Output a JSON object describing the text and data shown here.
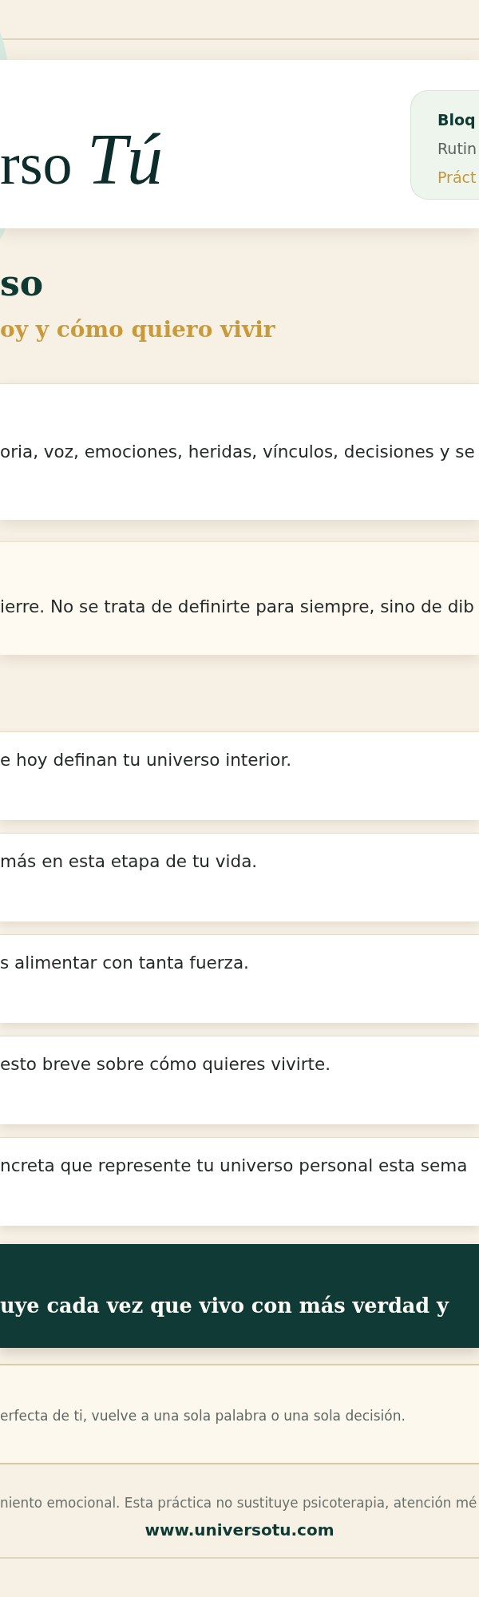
{
  "header": {
    "logo": {
      "text": "rso",
      "accent": "Tú"
    },
    "badge": {
      "lines": [
        {
          "kind": "title",
          "text": "Bloq"
        },
        {
          "kind": "subtitle",
          "text": "Rutin"
        },
        {
          "kind": "tag",
          "text": "Práct"
        }
      ]
    }
  },
  "hero": {
    "title": "so",
    "subtitle": "oy y cómo quiero vivir"
  },
  "intro_cards": [
    {
      "kind": "plain",
      "text": "oria, voz, emociones, heridas, vínculos, decisiones y se"
    },
    {
      "kind": "highlight",
      "text": "ierre. No se trata de definirte para siempre, sino de dib"
    }
  ],
  "prompts": [
    {
      "text": "e hoy definan tu universo interior."
    },
    {
      "text": "más en esta etapa de tu vida."
    },
    {
      "text": "s alimentar con tanta fuerza."
    },
    {
      "text": "esto breve sobre cómo quieres vivirte."
    },
    {
      "text": "ncreta que represente tu universo personal esta sema"
    }
  ],
  "quote": {
    "text": "uye cada vez que vivo con más verdad y"
  },
  "note": {
    "text": "erfecta de ti, vuelve a una sola palabra o una sola decisión."
  },
  "footer": {
    "disclaimer": "niento emocional. Esta práctica no sustituye psicoterapia, atención mé",
    "url": "www.universotu.com"
  }
}
